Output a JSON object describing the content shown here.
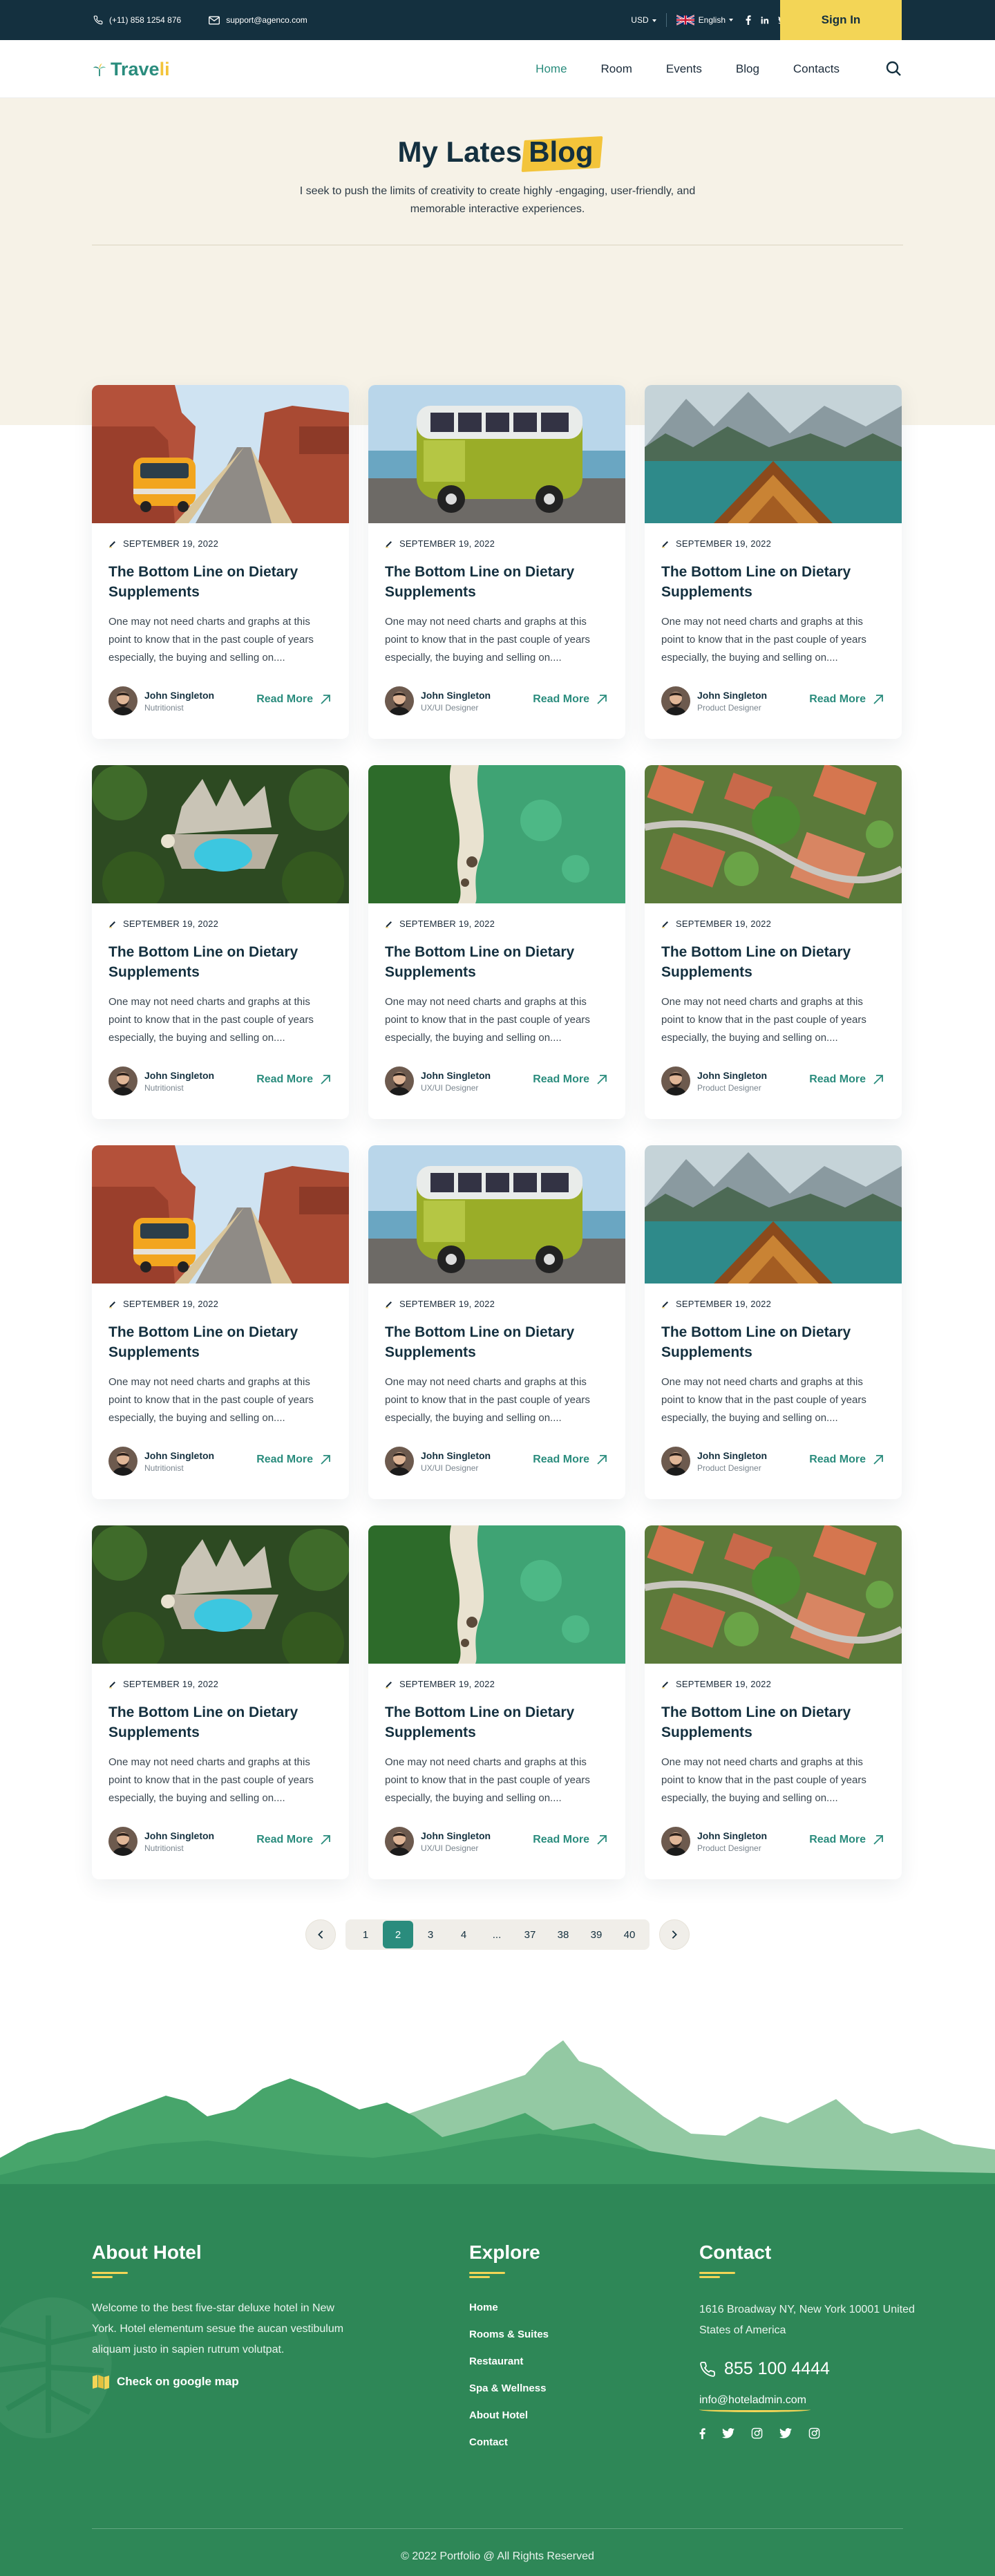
{
  "topbar": {
    "phone": "(+11) 858 1254 876",
    "email": "support@agenco.com",
    "currency": "USD",
    "language": "English",
    "signin_label": "Sign In"
  },
  "brand": {
    "name_a": "Trave",
    "name_b": "li"
  },
  "nav": {
    "items": [
      "Home",
      "Room",
      "Events",
      "Blog",
      "Contacts"
    ],
    "active": "Home"
  },
  "hero": {
    "title_main": "My Lates",
    "title_highlight": "Blog",
    "subtitle": "I seek to push the limits of creativity to create highly -engaging, user-friendly, and memorable interactive experiences."
  },
  "posts": [
    {
      "image": "desert-road-van",
      "date": "SEPTEMBER 19, 2022",
      "title": "The Bottom Line on Dietary Supplements",
      "excerpt": "One may not need charts and graphs at this point to know that in the past couple of years especially, the buying and selling on....",
      "author": "John Singleton",
      "role": "Nutritionist",
      "cta": "Read More"
    },
    {
      "image": "green-van-beach",
      "date": "SEPTEMBER 19, 2022",
      "title": "The Bottom Line on Dietary Supplements",
      "excerpt": "One may not need charts and graphs at this point to know that in the past couple of years especially, the buying and selling on....",
      "author": "John Singleton",
      "role": "UX/UI Designer",
      "cta": "Read More"
    },
    {
      "image": "lake-boat",
      "date": "SEPTEMBER 19, 2022",
      "title": "The Bottom Line on Dietary Supplements",
      "excerpt": "One may not need charts and graphs at this point to know that in the past couple of years especially, the buying and selling on....",
      "author": "John Singleton",
      "role": "Product Designer",
      "cta": "Read More"
    },
    {
      "image": "resort-pool",
      "date": "SEPTEMBER 19, 2022",
      "title": "The Bottom Line on Dietary Supplements",
      "excerpt": "One may not need charts and graphs at this point to know that in the past couple of years especially, the buying and selling on....",
      "author": "John Singleton",
      "role": "Nutritionist",
      "cta": "Read More"
    },
    {
      "image": "aerial-beach",
      "date": "SEPTEMBER 19, 2022",
      "title": "The Bottom Line on Dietary Supplements",
      "excerpt": "One may not need charts and graphs at this point to know that in the past couple of years especially, the buying and selling on....",
      "author": "John Singleton",
      "role": "UX/UI Designer",
      "cta": "Read More"
    },
    {
      "image": "aerial-roofs",
      "date": "SEPTEMBER 19, 2022",
      "title": "The Bottom Line on Dietary Supplements",
      "excerpt": "One may not need charts and graphs at this point to know that in the past couple of years especially, the buying and selling on....",
      "author": "John Singleton",
      "role": "Product Designer",
      "cta": "Read More"
    },
    {
      "image": "desert-road-van",
      "date": "SEPTEMBER 19, 2022",
      "title": "The Bottom Line on Dietary Supplements",
      "excerpt": "One may not need charts and graphs at this point to know that in the past couple of years especially, the buying and selling on....",
      "author": "John Singleton",
      "role": "Nutritionist",
      "cta": "Read More"
    },
    {
      "image": "green-van-beach",
      "date": "SEPTEMBER 19, 2022",
      "title": "The Bottom Line on Dietary Supplements",
      "excerpt": "One may not need charts and graphs at this point to know that in the past couple of years especially, the buying and selling on....",
      "author": "John Singleton",
      "role": "UX/UI Designer",
      "cta": "Read More"
    },
    {
      "image": "lake-boat",
      "date": "SEPTEMBER 19, 2022",
      "title": "The Bottom Line on Dietary Supplements",
      "excerpt": "One may not need charts and graphs at this point to know that in the past couple of years especially, the buying and selling on....",
      "author": "John Singleton",
      "role": "Product Designer",
      "cta": "Read More"
    },
    {
      "image": "resort-pool",
      "date": "SEPTEMBER 19, 2022",
      "title": "The Bottom Line on Dietary Supplements",
      "excerpt": "One may not need charts and graphs at this point to know that in the past couple of years especially, the buying and selling on....",
      "author": "John Singleton",
      "role": "Nutritionist",
      "cta": "Read More"
    },
    {
      "image": "aerial-beach",
      "date": "SEPTEMBER 19, 2022",
      "title": "The Bottom Line on Dietary Supplements",
      "excerpt": "One may not need charts and graphs at this point to know that in the past couple of years especially, the buying and selling on....",
      "author": "John Singleton",
      "role": "UX/UI Designer",
      "cta": "Read More"
    },
    {
      "image": "aerial-roofs",
      "date": "SEPTEMBER 19, 2022",
      "title": "The Bottom Line on Dietary Supplements",
      "excerpt": "One may not need charts and graphs at this point to know that in the past couple of years especially, the buying and selling on....",
      "author": "John Singleton",
      "role": "Product Designer",
      "cta": "Read More"
    }
  ],
  "pagination": {
    "pages": [
      "1",
      "2",
      "3",
      "4",
      "...",
      "37",
      "38",
      "39",
      "40"
    ],
    "current": "2"
  },
  "footer": {
    "about_title": "About Hotel",
    "about_text": "Welcome to the best five-star deluxe hotel in New York. Hotel elementum sesue the aucan vestibulum aliquam justo in sapien rutrum volutpat.",
    "map_link": "Check on google map",
    "explore_title": "Explore",
    "explore_links": [
      "Home",
      "Rooms & Suites",
      "Restaurant",
      "Spa & Wellness",
      "About Hotel",
      "Contact"
    ],
    "contact_title": "Contact",
    "address": "1616 Broadway NY, New York 10001 United States of America",
    "phone": "855 100 4444",
    "email": "info@hoteladmin.com",
    "copyright": "© 2022 Portfolio @ All Rights Reserved"
  },
  "colors": {
    "navy": "#14303f",
    "teal": "#2a8c7d",
    "yellow": "#f3d556",
    "hero_bg": "#f6f2e7",
    "footer_green": "#2e8757"
  }
}
